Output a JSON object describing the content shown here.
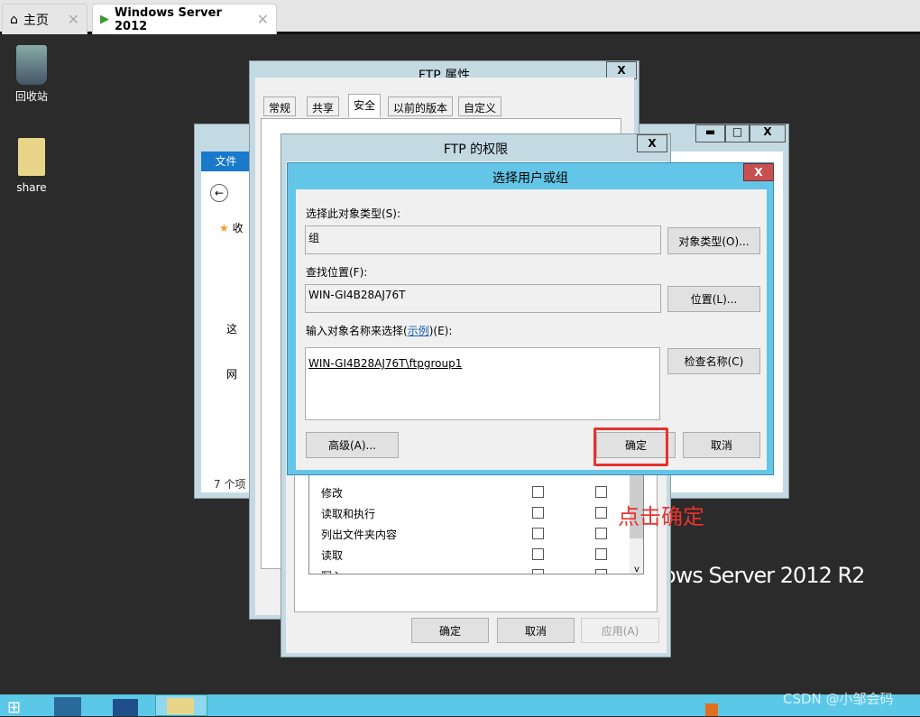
{
  "browser_tabs": [
    {
      "label": "主页",
      "icon": "home-icon"
    },
    {
      "label": "Windows Server 2012",
      "icon": "vm-icon",
      "active": true
    }
  ],
  "desktop": {
    "icons": [
      {
        "label": "回收站",
        "icon": "recycle-bin-icon"
      },
      {
        "label": "share",
        "icon": "folder-icon"
      }
    ],
    "branding": "ows Server 2012 R2"
  },
  "explorer": {
    "ribbon_file": "文件",
    "nav": [
      "收",
      "这",
      "网"
    ],
    "status": "7 个项"
  },
  "props": {
    "title": "FTP 属性",
    "tabs": [
      "常规",
      "共享",
      "安全",
      "以前的版本",
      "自定义"
    ],
    "active_tab": "安全"
  },
  "perm": {
    "title": "FTP 的权限",
    "rows": [
      "修改",
      "读取和执行",
      "列出文件夹内容",
      "读取",
      "写入"
    ],
    "ok": "确定",
    "cancel": "取消",
    "apply": "应用(A)"
  },
  "select": {
    "title": "选择用户或组",
    "type_label": "选择此对象类型(S):",
    "type_value": "组",
    "type_btn": "对象类型(O)...",
    "loc_label": "查找位置(F):",
    "loc_value": "WIN-GI4B28AJ76T",
    "loc_btn": "位置(L)...",
    "name_label_pre": "输入对象名称来选择(",
    "name_label_link": "示例",
    "name_label_post": ")(E):",
    "name_value": "WIN-GI4B28AJ76T\\ftpgroup1",
    "check_btn": "检查名称(C)",
    "advanced_btn": "高级(A)...",
    "ok": "确定",
    "cancel": "取消"
  },
  "annotation": "点击确定",
  "watermark": "CSDN @小邹会码",
  "colors": {
    "accent": "#63c6e8",
    "annotation": "#e8322d",
    "close_red": "#c75050"
  }
}
